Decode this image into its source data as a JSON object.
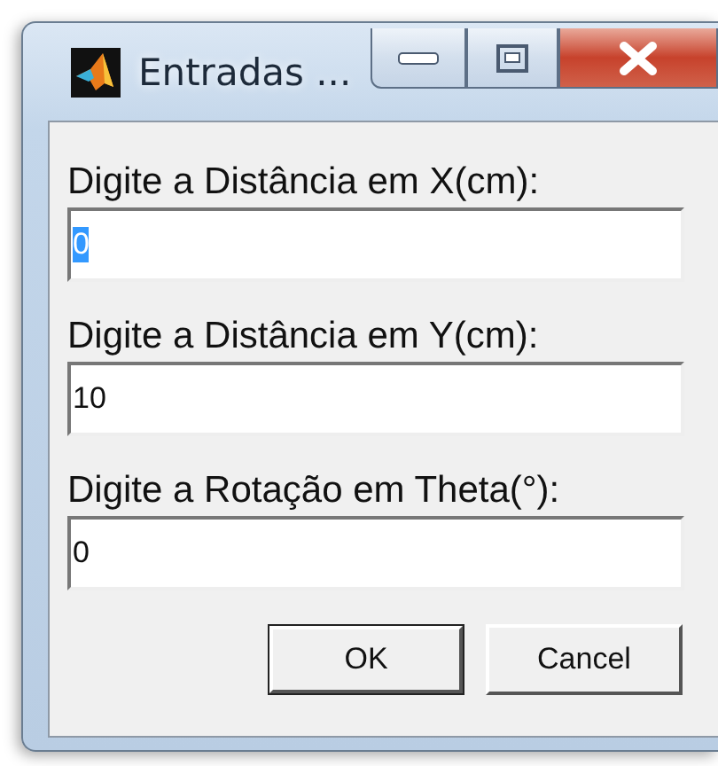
{
  "window": {
    "title": "Entradas ..."
  },
  "fields": [
    {
      "label": "Digite a Distância em X(cm):",
      "value": "0",
      "text_selected": true
    },
    {
      "label": "Digite a Distância em Y(cm):",
      "value": "10",
      "text_selected": false
    },
    {
      "label": "Digite a Rotação em Theta(°):",
      "value": "0",
      "text_selected": false
    }
  ],
  "buttons": [
    {
      "label": "OK",
      "default": true
    },
    {
      "label": "Cancel",
      "default": false
    }
  ]
}
